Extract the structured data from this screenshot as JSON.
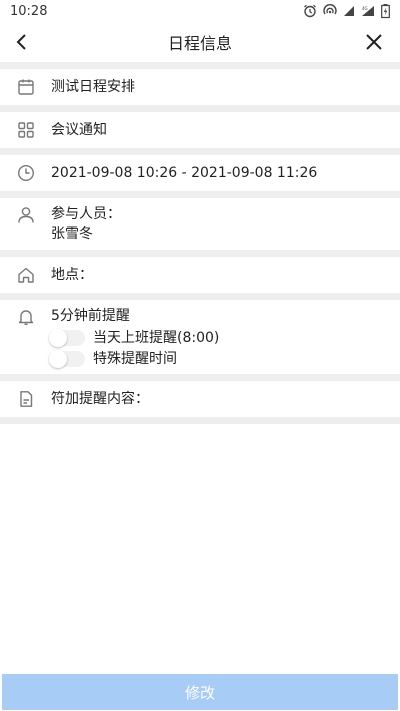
{
  "status_bar": {
    "time": "10:28"
  },
  "nav": {
    "title": "日程信息"
  },
  "schedule": {
    "title": "测试日程安排",
    "type": "会议通知",
    "time_range": "2021-09-08 10:26 - 2021-09-08 11:26",
    "participants_label": "参与人员：",
    "participants_value": "张雪冬",
    "location_label": "地点：",
    "reminder_label": "5分钟前提醒",
    "reminder_options": [
      {
        "label": "当天上班提醒(8:00)",
        "enabled": false
      },
      {
        "label": "特殊提醒时间",
        "enabled": false
      }
    ],
    "extra_label": "符加提醒内容："
  },
  "footer": {
    "submit_label": "修改"
  }
}
